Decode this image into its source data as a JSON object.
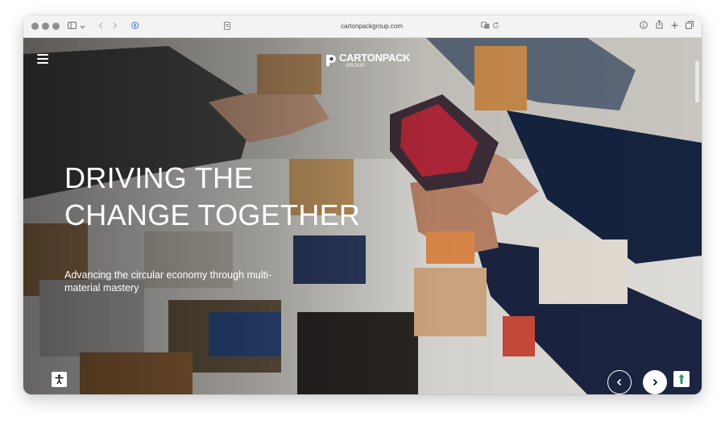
{
  "browser": {
    "url": "cartonpackgroup.com",
    "icons": [
      "sidebar-toggle-icon",
      "chevron-down-icon",
      "back-icon",
      "forward-icon",
      "privacy-shield-icon",
      "page-icon",
      "translate-icon",
      "reload-icon",
      "info-icon",
      "share-icon",
      "new-tab-icon",
      "tabs-overview-icon"
    ]
  },
  "header": {
    "logo_brand": "CARTONPACK",
    "logo_sub": "GROUP"
  },
  "hero": {
    "headline_line1": "DRIVING THE",
    "headline_line2": "CHANGE TOGETHER",
    "subline": "Advancing the circular economy through multi-material mastery"
  },
  "colors": {
    "accent_green": "#1e9e5a",
    "hero_text": "#ffffff"
  }
}
